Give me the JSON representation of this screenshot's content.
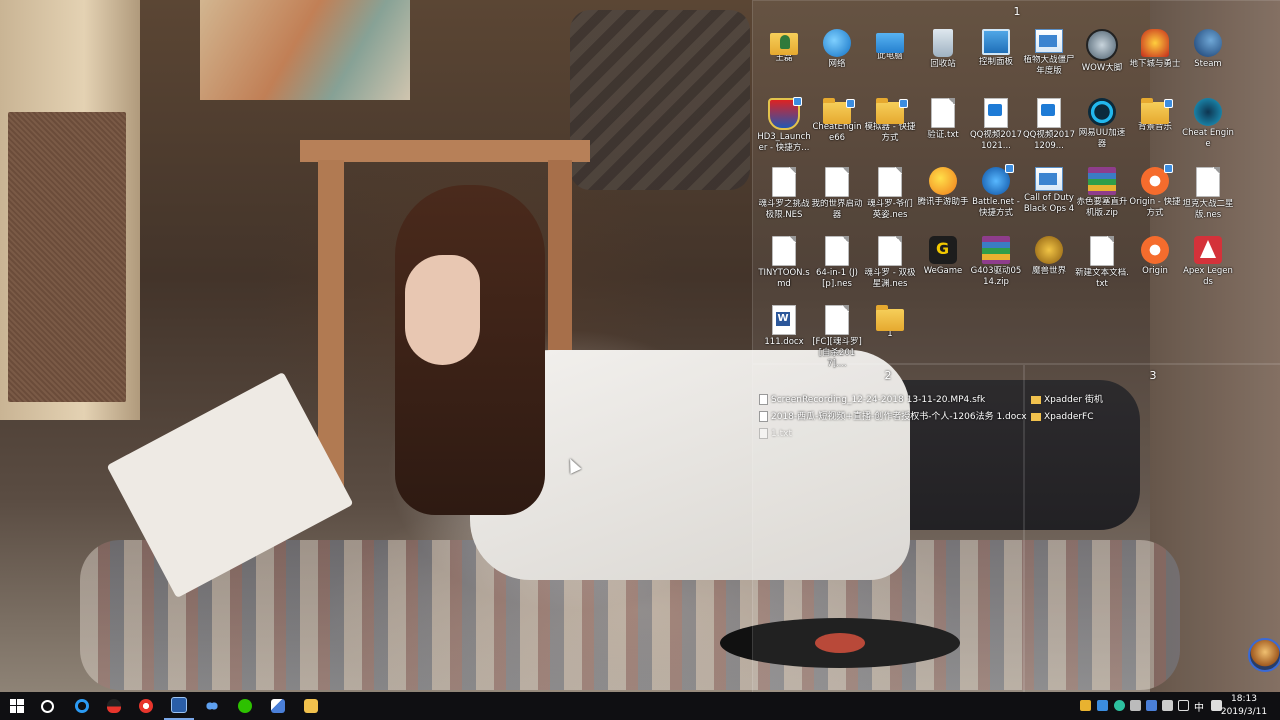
{
  "fences": {
    "fence1": {
      "title": "1"
    },
    "fence2": {
      "title": "2"
    },
    "fence3": {
      "title": "3"
    }
  },
  "desktop_icons": [
    {
      "label": "王磊",
      "icon": "user-folder-icon"
    },
    {
      "label": "网络",
      "icon": "network-icon"
    },
    {
      "label": "此电脑",
      "icon": "this-pc-icon"
    },
    {
      "label": "回收站",
      "icon": "recycle-bin-icon"
    },
    {
      "label": "控制面板",
      "icon": "control-panel-icon"
    },
    {
      "label": "植物大战僵尸年度版",
      "icon": "window-icon"
    },
    {
      "label": "WOW大脚",
      "icon": "wow-bigfoot-icon"
    },
    {
      "label": "地下城与勇士",
      "icon": "dnf-icon"
    },
    {
      "label": "Steam",
      "icon": "steam-icon"
    },
    {
      "label": "HD3_Launcher - 快捷方...",
      "icon": "heroes-shield-icon"
    },
    {
      "label": "CheatEngine66",
      "icon": "folder-icon"
    },
    {
      "label": "模拟器 - 快捷方式",
      "icon": "folder-icon"
    },
    {
      "label": "验证.txt",
      "icon": "text-file-icon"
    },
    {
      "label": "QQ视频20171021...",
      "icon": "video-file-icon"
    },
    {
      "label": "QQ视频20171209...",
      "icon": "video-file-icon"
    },
    {
      "label": "网易UU加速器",
      "icon": "uu-accelerator-icon"
    },
    {
      "label": "背景音乐",
      "icon": "folder-icon"
    },
    {
      "label": "Cheat Engine",
      "icon": "cheat-engine-icon"
    },
    {
      "label": "魂斗罗之挑战极限.NES",
      "icon": "file-icon"
    },
    {
      "label": "我的世界启动器",
      "icon": "file-icon"
    },
    {
      "label": "魂斗罗-爷们英姿.nes",
      "icon": "file-icon"
    },
    {
      "label": "腾讯手游助手",
      "icon": "tencent-gamebox-icon"
    },
    {
      "label": "Battle.net - 快捷方式",
      "icon": "battlenet-icon"
    },
    {
      "label": "Call of Duty Black Ops 4",
      "icon": "window-icon"
    },
    {
      "label": "赤色要塞直升机版.zip",
      "icon": "zip-icon"
    },
    {
      "label": "Origin - 快捷方式",
      "icon": "origin-icon"
    },
    {
      "label": "坦克大战二星版.nes",
      "icon": "file-icon"
    },
    {
      "label": "TINYTOON.smd",
      "icon": "file-icon"
    },
    {
      "label": "64-in-1 (J)[p].nes",
      "icon": "file-icon"
    },
    {
      "label": "魂斗罗 - 双极星渊.nes",
      "icon": "file-icon"
    },
    {
      "label": "WeGame",
      "icon": "wegame-icon"
    },
    {
      "label": "G403驱动0514.zip",
      "icon": "zip-icon"
    },
    {
      "label": "魔兽世界",
      "icon": "warcraft-icon"
    },
    {
      "label": "新建文本文档.txt",
      "icon": "text-file-icon"
    },
    {
      "label": "Origin",
      "icon": "origin-icon"
    },
    {
      "label": "Apex Legends",
      "icon": "apex-icon"
    },
    {
      "label": "111.docx",
      "icon": "word-doc-icon"
    },
    {
      "label": "[FC][魂斗罗][自杀2017]....",
      "icon": "file-icon"
    },
    {
      "label": "1",
      "icon": "folder-icon"
    }
  ],
  "fence2_items": [
    {
      "label": "ScreenRecording_12-24-2018 13-11-20.MP4.sfk",
      "icon": "file-icon"
    },
    {
      "label": "2018-西瓜-短视频+直播-创作者授权书-个人-1206法务 1.docx",
      "icon": "file-icon"
    },
    {
      "label": "1.txt",
      "icon": "file-icon"
    }
  ],
  "fence3_items": [
    {
      "label": "Xpadder 街机",
      "icon": "folder-icon"
    },
    {
      "label": "XpadderFC",
      "icon": "folder-icon"
    }
  ],
  "taskbar": {
    "clock_time": "18:13",
    "clock_date": "2019/3/11",
    "ime_label": "中",
    "apps": [
      {
        "name": "start-button",
        "icon": "windows-logo-icon"
      },
      {
        "name": "cortana-button",
        "icon": "cortana-ring-icon"
      },
      {
        "name": "taskbar-browser",
        "icon": "browser-icon"
      },
      {
        "name": "taskbar-penguin",
        "icon": "qq-icon"
      },
      {
        "name": "taskbar-media-player",
        "icon": "media-player-icon"
      },
      {
        "name": "taskbar-vs",
        "icon": "visual-studio-icon"
      },
      {
        "name": "taskbar-baidu",
        "icon": "baidu-netdisk-icon"
      },
      {
        "name": "taskbar-wechat",
        "icon": "wechat-icon"
      },
      {
        "name": "taskbar-feather",
        "icon": "feather-app-icon"
      },
      {
        "name": "taskbar-folder",
        "icon": "file-explorer-icon"
      }
    ]
  },
  "colors": {
    "taskbar_bg": "#0f0f12",
    "fence_bg": "rgba(255,255,255,0.07)",
    "accent": "#1e7bd6"
  }
}
